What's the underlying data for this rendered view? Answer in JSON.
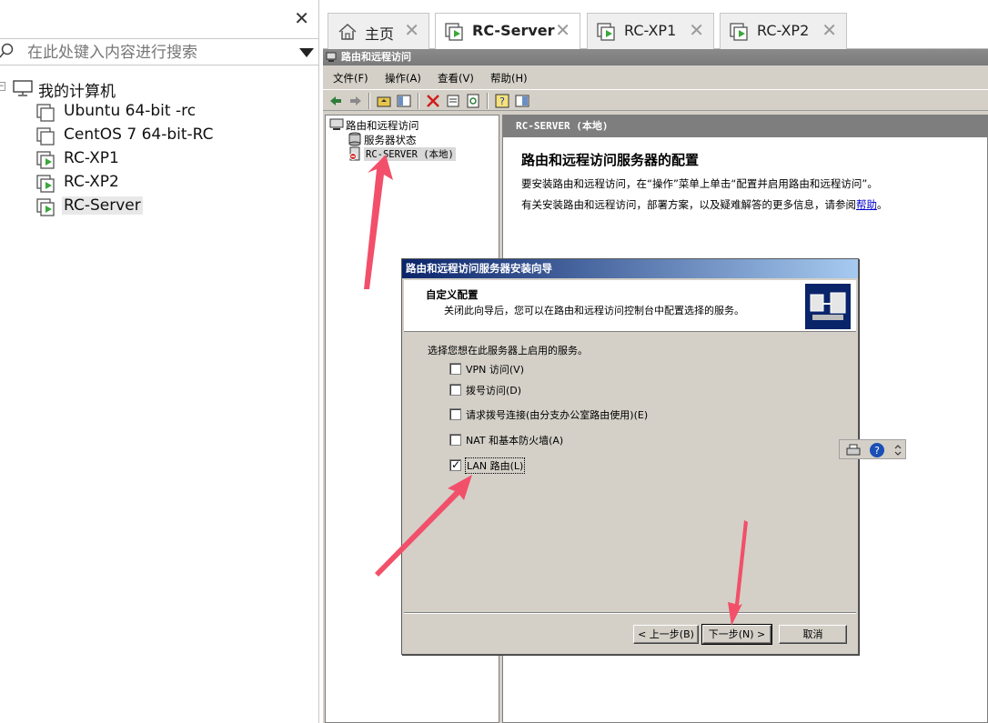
{
  "library": {
    "search_placeholder": "在此处键入内容进行搜索",
    "root_label": "我的计算机",
    "vms": [
      {
        "label": "Ubuntu 64-bit -rc",
        "running": false
      },
      {
        "label": "CentOS 7 64-bit-RC",
        "running": false
      },
      {
        "label": "RC-XP1",
        "running": true
      },
      {
        "label": "RC-XP2",
        "running": true
      },
      {
        "label": "RC-Server",
        "running": true,
        "selected": true
      }
    ]
  },
  "tabs": [
    {
      "label": "主页",
      "icon": "home-icon"
    },
    {
      "label": "RC-Server",
      "icon": "vm-running-icon",
      "active": true
    },
    {
      "label": "RC-XP1",
      "icon": "vm-running-icon"
    },
    {
      "label": "RC-XP2",
      "icon": "vm-running-icon"
    }
  ],
  "mmc": {
    "title": "路由和远程访问",
    "menu": [
      "文件(F)",
      "操作(A)",
      "查看(V)",
      "帮助(H)"
    ],
    "tree": {
      "root": "路由和远程访问",
      "status": "服务器状态",
      "server": "RC-SERVER (本地)"
    },
    "content": {
      "header": "RC-SERVER (本地)",
      "title": "路由和远程访问服务器的配置",
      "line1": "要安装路由和远程访问，在“操作”菜单上单击“配置并启用路由和远程访问”。",
      "line2_prefix": "有关安装路由和远程访问，部署方案，以及疑难解答的更多信息，请参阅",
      "line2_link": "帮助",
      "line2_suffix": "。"
    }
  },
  "wizard": {
    "title": "路由和远程访问服务器安装向导",
    "heading": "自定义配置",
    "subheading": "关闭此向导后，您可以在路由和远程访问控制台中配置选择的服务。",
    "prompt": "选择您想在此服务器上启用的服务。",
    "options": [
      {
        "label": "VPN 访问(V)",
        "checked": false
      },
      {
        "label": "拨号访问(D)",
        "checked": false
      },
      {
        "label": "请求拨号连接(由分支办公室路由使用)(E)",
        "checked": false
      },
      {
        "label": "NAT 和基本防火墙(A)",
        "checked": false
      },
      {
        "label": "LAN 路由(L)",
        "checked": true
      }
    ],
    "buttons": {
      "back": "< 上一步(B)",
      "next": "下一步(N) >",
      "cancel": "取消"
    }
  },
  "colors": {
    "arrow": "#f2506a",
    "wizard_title_start": "#0a246a",
    "vm_running": "#3aa83a"
  }
}
